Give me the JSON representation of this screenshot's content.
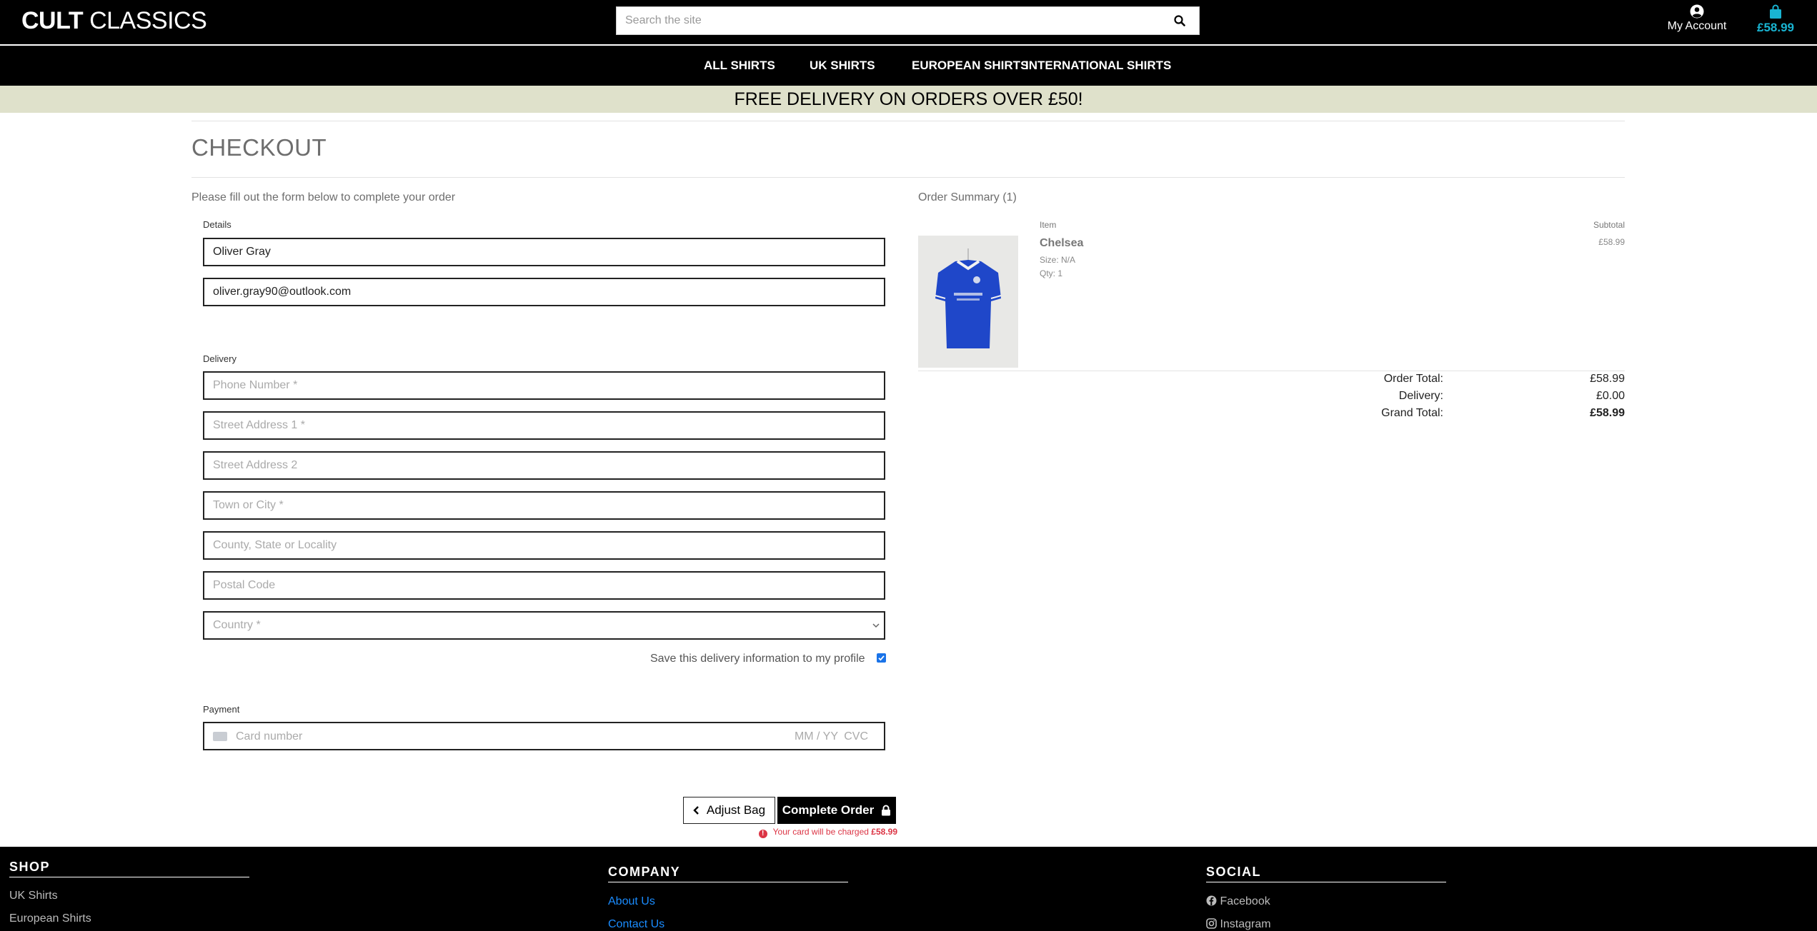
{
  "header": {
    "logo_bold": "CULT",
    "logo_rest": " CLASSICS",
    "search_placeholder": "Search the site",
    "account_label": "My Account",
    "bag_total": "£58.99",
    "nav": [
      "ALL SHIRTS",
      "UK SHIRTS",
      "EUROPEAN SHIRTS",
      "INTERNATIONAL SHIRTS"
    ],
    "banner": "FREE DELIVERY ON ORDERS OVER £50!"
  },
  "checkout": {
    "title": "CHECKOUT",
    "intro": "Please fill out the form below to complete your order",
    "details_label": "Details",
    "full_name": "Oliver Gray",
    "email": "oliver.gray90@outlook.com",
    "delivery_label": "Delivery",
    "placeholders": {
      "phone": "Phone Number *",
      "street1": "Street Address 1 *",
      "street2": "Street Address 2",
      "town": "Town or City *",
      "county": "County, State or Locality",
      "postcode": "Postal Code",
      "country": "Country *"
    },
    "save_info_label": "Save this delivery information to my profile",
    "save_info_checked": true,
    "payment_label": "Payment",
    "card_placeholder": "Card number",
    "card_expiry_placeholder": "MM / YY",
    "card_cvc_placeholder": "CVC",
    "adjust_bag_label": "Adjust Bag",
    "complete_order_label": "Complete Order",
    "charge_text": "Your card will be charged",
    "charge_amount": "£58.99"
  },
  "summary": {
    "title": "Order Summary (1)",
    "col_item": "Item",
    "col_subtotal": "Subtotal",
    "items": [
      {
        "name": "Chelsea",
        "size": "Size: N/A",
        "qty": "Qty: 1",
        "subtotal": "£58.99"
      }
    ],
    "order_total_label": "Order Total:",
    "order_total": "£58.99",
    "delivery_label": "Delivery:",
    "delivery": "£0.00",
    "grand_total_label": "Grand Total:",
    "grand_total": "£58.99"
  },
  "footer": {
    "shop_heading": "SHOP",
    "shop_links": [
      "UK Shirts",
      "European Shirts"
    ],
    "company_heading": "COMPANY",
    "company_links": [
      "About Us",
      "Contact Us"
    ],
    "social_heading": "SOCIAL",
    "social_links": [
      "Facebook",
      "Instagram"
    ]
  },
  "colors": {
    "accent_bag": "#19b4d2",
    "banner_bg": "#dfe1cb",
    "link_blue": "#1a8cff",
    "error_red": "#dc3545"
  }
}
